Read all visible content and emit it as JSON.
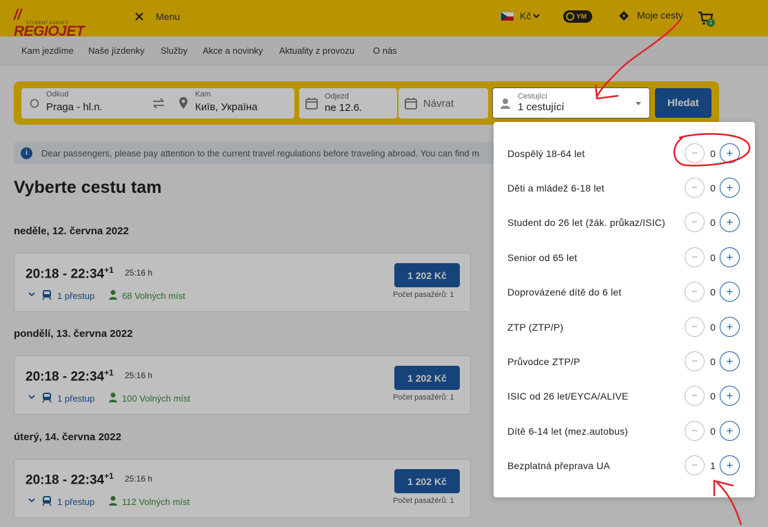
{
  "header": {
    "logo_text": "// REGIOJET",
    "logo_sub": "STUDENT AGENCY",
    "menu_label": "Menu",
    "currency": "Kč",
    "user_initials": "YM",
    "my_trips": "Moje cesty",
    "cart_count": "1"
  },
  "nav": [
    "Kam jezdíme",
    "Naše jízdenky",
    "Služby",
    "Akce a novinky",
    "Aktuality z provozu",
    "O nás"
  ],
  "search": {
    "from_label": "Odkud",
    "from_value": "Praga - hl.n.",
    "to_label": "Kam",
    "to_value": "Київ, Україна",
    "depart_label": "Odjezd",
    "depart_value": "ne 12.6.",
    "return_placeholder": "Návrat",
    "passengers_label": "Cestující",
    "passengers_value": "1 cestující",
    "search_button": "Hledat"
  },
  "info_text": "Dear passengers, please pay attention to the current travel regulations before traveling abroad. You can find m",
  "page_title": "Vyberte cestu tam",
  "days": [
    {
      "heading": "neděle, 12. června 2022",
      "time": "20:18 - 22:34",
      "plus_day": "+1",
      "duration": "25:16 h",
      "transfer": "1 přestup",
      "seats": "68 Volných míst",
      "price": "1 202 Kč",
      "price_note": "Počet pasažérů: 1"
    },
    {
      "heading": "pondělí, 13. června 2022",
      "time": "20:18 - 22:34",
      "plus_day": "+1",
      "duration": "25:16 h",
      "transfer": "1 přestup",
      "seats": "100 Volných míst",
      "price": "1 202 Kč",
      "price_note": "Počet pasažérů: 1"
    },
    {
      "heading": "úterý, 14. června 2022",
      "time": "20:18 - 22:34",
      "plus_day": "+1",
      "duration": "25:16 h",
      "transfer": "1 přestup",
      "seats": "112 Volných míst",
      "price": "1 202 Kč",
      "price_note": "Počet pasažérů: 1"
    }
  ],
  "passenger_types": [
    {
      "label": "Dospělý 18-64 let",
      "count": "0"
    },
    {
      "label": "Děti a mládež 6-18 let",
      "count": "0"
    },
    {
      "label": "Student do 26 let (žák. průkaz/ISIC)",
      "count": "0"
    },
    {
      "label": "Senior od 65 let",
      "count": "0"
    },
    {
      "label": "Doprovázené dítě do 6 let",
      "count": "0"
    },
    {
      "label": "ZTP (ZTP/P)",
      "count": "0"
    },
    {
      "label": "Průvodce ZTP/P",
      "count": "0"
    },
    {
      "label": "ISIC od 26 let/EYCA/ALIVE",
      "count": "0"
    },
    {
      "label": "Dítě 6-14 let (mez.autobus)",
      "count": "0"
    },
    {
      "label": "Bezplatná přeprava UA",
      "count": "1"
    }
  ],
  "controls": {
    "minus": "−",
    "plus": "+"
  },
  "colors": {
    "brand_yellow": "#f7c600",
    "primary_blue": "#1c5aa3",
    "seats_green": "#3b8d3a",
    "annotation_red": "#e0262c"
  }
}
